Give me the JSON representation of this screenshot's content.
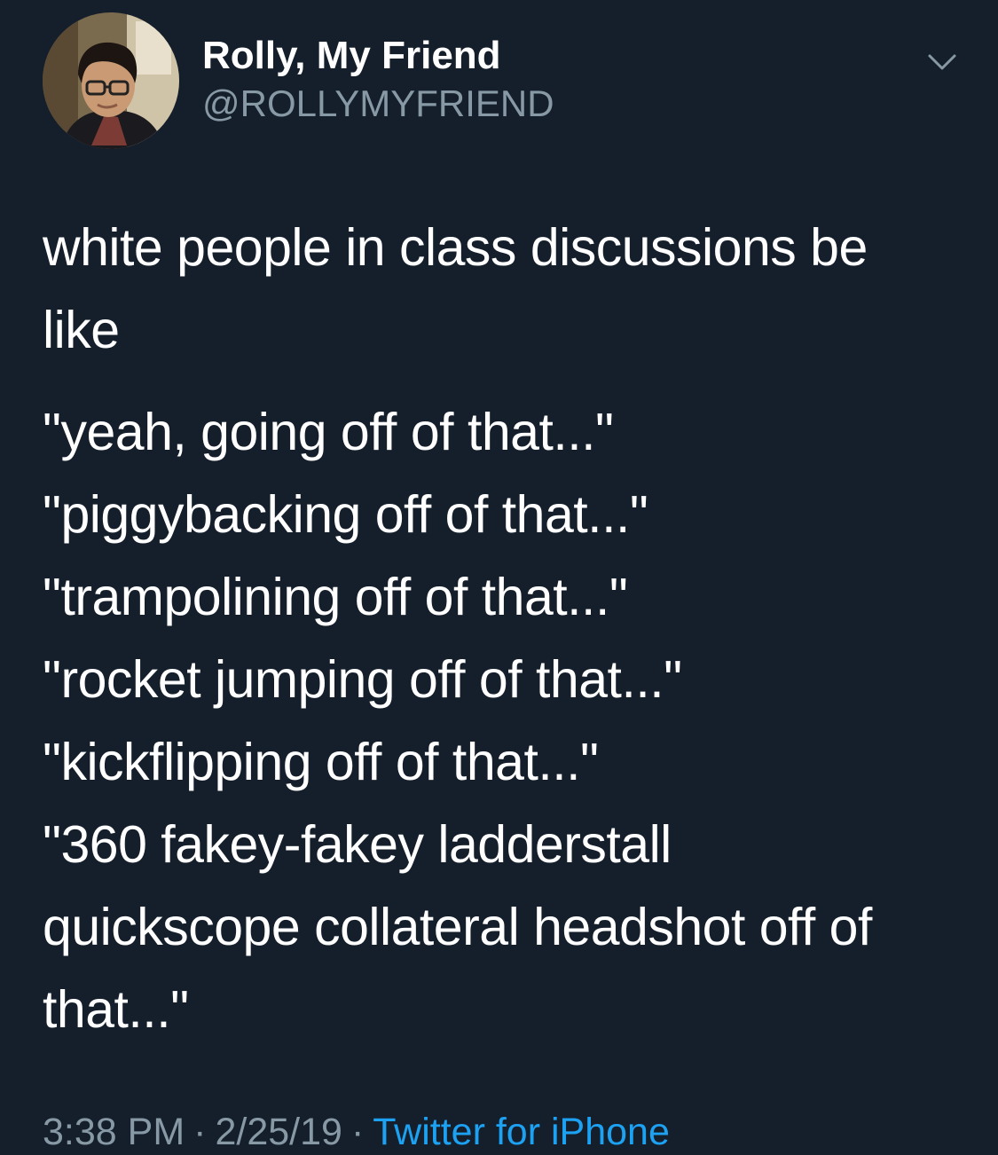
{
  "author": {
    "name": "Rolly, My Friend",
    "handle": "@ROLLYMYFRIEND"
  },
  "tweet": {
    "paragraph1": [
      "white people in class discussions be",
      "like"
    ],
    "paragraph2": [
      "\"yeah, going off of that...\"",
      "\"piggybacking off of that...\"",
      "\"trampolining off of that...\"",
      "\"rocket jumping off of that...\"",
      "\"kickflipping off of that...\"",
      "\"360 fakey-fakey ladderstall",
      "quickscope collateral headshot off of",
      "that...\""
    ]
  },
  "meta": {
    "time": "3:38 PM",
    "separator": "·",
    "date": "2/25/19",
    "source": "Twitter for iPhone"
  },
  "colors": {
    "background": "#151f2b",
    "text": "#ffffff",
    "secondary": "#8899a6",
    "link": "#1da1f2"
  },
  "icons": {
    "menu": "chevron-down-icon",
    "avatar": "profile-photo"
  }
}
